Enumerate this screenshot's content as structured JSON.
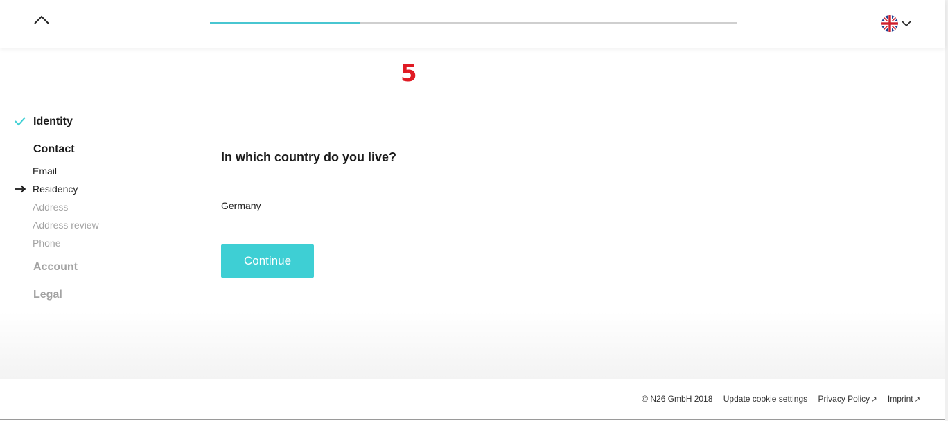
{
  "header": {
    "progress_fraction": 0.285,
    "progress_fill_color": "#48c6d1",
    "collapse_icon": "chevron-up-icon",
    "language_icon": "uk-flag-icon",
    "language_chevron_icon": "chevron-down-icon"
  },
  "step_marker": "5",
  "sidebar": {
    "identity": {
      "label": "Identity",
      "icon": "check-icon"
    },
    "contact": {
      "label": "Contact"
    },
    "email": {
      "label": "Email"
    },
    "residency": {
      "label": "Residency",
      "icon": "arrow-right-icon"
    },
    "address": {
      "label": "Address"
    },
    "address_review": {
      "label": "Address review"
    },
    "phone": {
      "label": "Phone"
    },
    "account": {
      "label": "Account"
    },
    "legal": {
      "label": "Legal"
    }
  },
  "main": {
    "question": "In which country do you live?",
    "country_value": "Germany",
    "continue_label": "Continue",
    "accent_color": "#3ecfd4"
  },
  "footer": {
    "copyright": "© N26 GmbH 2018",
    "cookie_settings": "Update cookie settings",
    "privacy_policy": "Privacy Policy",
    "imprint": "Imprint",
    "external_icon": "↗"
  }
}
